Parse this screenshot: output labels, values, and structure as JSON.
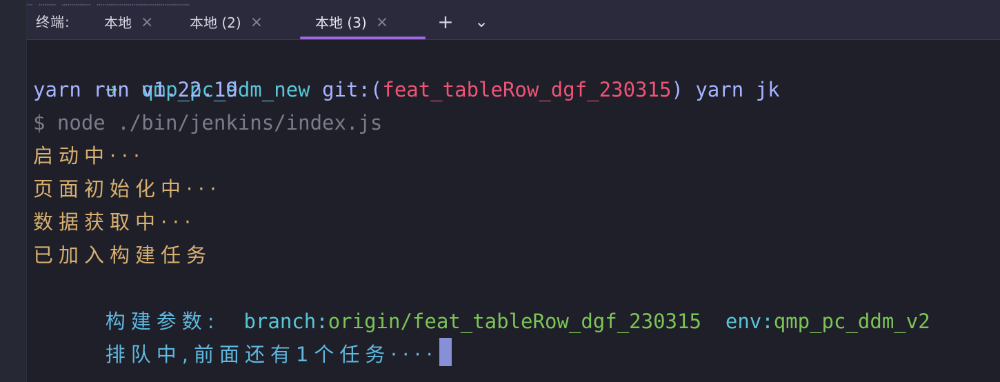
{
  "tabbar": {
    "top_fragment": "… ………  …………… …………………………………………",
    "prefix": "终端:",
    "tabs": [
      {
        "label": "本地",
        "active": false
      },
      {
        "label": "本地 (2)",
        "active": false
      },
      {
        "label": "本地 (3)",
        "active": true
      }
    ],
    "close_symbol": "×",
    "add_symbol": "+",
    "dropdown_symbol": "⌄"
  },
  "terminal": {
    "prompt_arrow": "➜",
    "project": "qmp_pc_ddm_new",
    "git_prefix": "git:",
    "branch_open": "(",
    "branch": "feat_tableRow_dgf_230315",
    "branch_close": ")",
    "command": "yarn jk",
    "line2": "yarn run v1.22.19",
    "line3": "$ node ./bin/jenkins/index.js",
    "line4": "启动中···",
    "line5": "页面初始化中···",
    "line6": "数据获取中···",
    "line7": "已加入构建任务",
    "line8_label": "构建参数:",
    "line8_branch_key": "branch:",
    "line8_branch_value": "origin/feat_tableRow_dgf_230315",
    "line8_env_key": "env:",
    "line8_env_value": "qmp_pc_ddm_v2",
    "line9": "排队中,前面还有1个任务····"
  },
  "colors": {
    "background": "#1e1f29",
    "tabbar": "#2b2a3c",
    "active_tab_underline": "#9f6adf",
    "cursor": "#878fd7"
  }
}
